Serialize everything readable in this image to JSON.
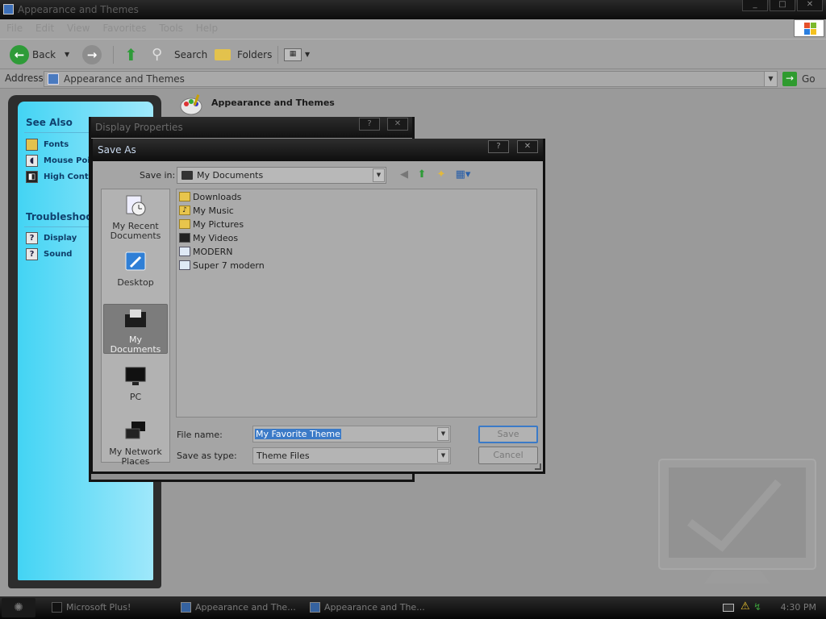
{
  "explorer": {
    "title": "Appearance and Themes",
    "menu": [
      "File",
      "Edit",
      "View",
      "Favorites",
      "Tools",
      "Help"
    ],
    "toolbar": {
      "back": "Back",
      "search": "Search",
      "folders": "Folders"
    },
    "address": {
      "label": "Address",
      "value": "Appearance and Themes",
      "go": "Go"
    },
    "sidebar": {
      "see_also_header": "See Also",
      "see_also": [
        "Fonts",
        "Mouse Pointers",
        "High Contrast"
      ],
      "troubleshooters_header": "Troubleshooters",
      "troubleshooters": [
        "Display",
        "Sound"
      ]
    },
    "content_title": "Appearance and Themes"
  },
  "display_properties": {
    "title": "Display Properties"
  },
  "save_as": {
    "title": "Save As",
    "save_in_label": "Save in:",
    "save_in_value": "My Documents",
    "places": [
      {
        "label": "My Recent Documents"
      },
      {
        "label": "Desktop"
      },
      {
        "label": "My Documents"
      },
      {
        "label": "PC"
      },
      {
        "label": "My Network Places"
      }
    ],
    "files": [
      {
        "name": "Downloads",
        "icon": "folder-icon"
      },
      {
        "name": "My Music",
        "icon": "music-folder-icon"
      },
      {
        "name": "My Pictures",
        "icon": "pictures-folder-icon"
      },
      {
        "name": "My Videos",
        "icon": "videos-folder-icon"
      },
      {
        "name": "MODERN",
        "icon": "theme-file-icon"
      },
      {
        "name": "Super 7 modern",
        "icon": "theme-file-icon"
      }
    ],
    "file_name_label": "File name:",
    "file_name_value": "My Favorite Theme",
    "save_as_type_label": "Save as type:",
    "save_as_type_value": "Theme Files",
    "save_button": "Save",
    "cancel_button": "Cancel"
  },
  "taskbar": {
    "tasks": [
      "Microsoft Plus!",
      "Appearance and The...",
      "Appearance and The..."
    ],
    "clock": "4:30 PM"
  },
  "colors": {
    "accent": "#3b7ac7",
    "sidebar_gradient_start": "#43d4f4",
    "sidebar_gradient_end": "#9fe8fb",
    "titlebar": "#111111"
  }
}
